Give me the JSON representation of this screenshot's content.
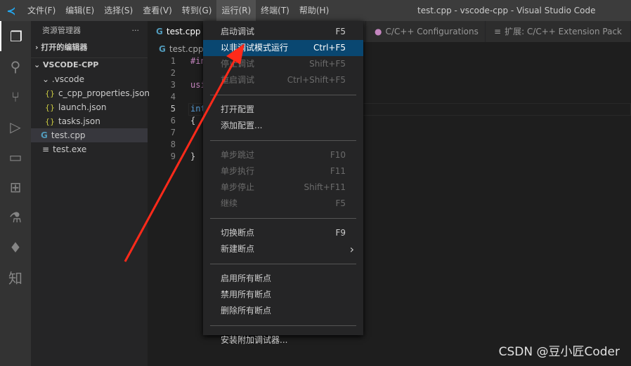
{
  "titlebar": {
    "menus": [
      "文件(F)",
      "编辑(E)",
      "选择(S)",
      "查看(V)",
      "转到(G)",
      "运行(R)",
      "终端(T)",
      "帮助(H)"
    ],
    "title": "test.cpp - vscode-cpp - Visual Studio Code"
  },
  "sidebar": {
    "header": "资源管理器",
    "more": "···",
    "open_editors": "打开的编辑器",
    "project": "VSCODE-CPP",
    "folder": ".vscode",
    "files": [
      "c_cpp_properties.json",
      "launch.json",
      "tasks.json"
    ],
    "root_files": [
      "test.cpp",
      "test.exe"
    ]
  },
  "tabs": [
    "test.cpp",
    "C/C++ Configurations",
    "扩展: C/C++ Extension Pack"
  ],
  "breadcrumb": "test.cpp",
  "editor": {
    "line_numbers": [
      "1",
      "2",
      "3",
      "4",
      "5",
      "6",
      "7",
      "8",
      "9"
    ],
    "code": [
      "#in",
      "",
      "usi",
      "",
      "int",
      "{",
      "",
      "",
      "}"
    ]
  },
  "run_menu": [
    {
      "label": "启动调试",
      "key": "F5"
    },
    {
      "label": "以非调试模式运行",
      "key": "Ctrl+F5",
      "highlight": true
    },
    {
      "label": "停止调试",
      "key": "Shift+F5",
      "disabled": true
    },
    {
      "label": "重启调试",
      "key": "Ctrl+Shift+F5",
      "disabled": true
    },
    {
      "sep": true
    },
    {
      "label": "打开配置",
      "key": ""
    },
    {
      "label": "添加配置...",
      "key": ""
    },
    {
      "sep": true
    },
    {
      "label": "单步跳过",
      "key": "F10",
      "disabled": true
    },
    {
      "label": "单步执行",
      "key": "F11",
      "disabled": true
    },
    {
      "label": "单步停止",
      "key": "Shift+F11",
      "disabled": true
    },
    {
      "label": "继续",
      "key": "F5",
      "disabled": true
    },
    {
      "sep": true
    },
    {
      "label": "切换断点",
      "key": "F9"
    },
    {
      "label": "新建断点",
      "key": "›"
    },
    {
      "sep": true
    },
    {
      "label": "启用所有断点",
      "key": ""
    },
    {
      "label": "禁用所有断点",
      "key": ""
    },
    {
      "label": "删除所有断点",
      "key": ""
    },
    {
      "sep": true
    },
    {
      "label": "安装附加调试器...",
      "key": ""
    }
  ],
  "watermark": "CSDN @豆小匠Coder",
  "colors": {
    "accent": "#094771",
    "arrow": "#ff2a1a"
  }
}
